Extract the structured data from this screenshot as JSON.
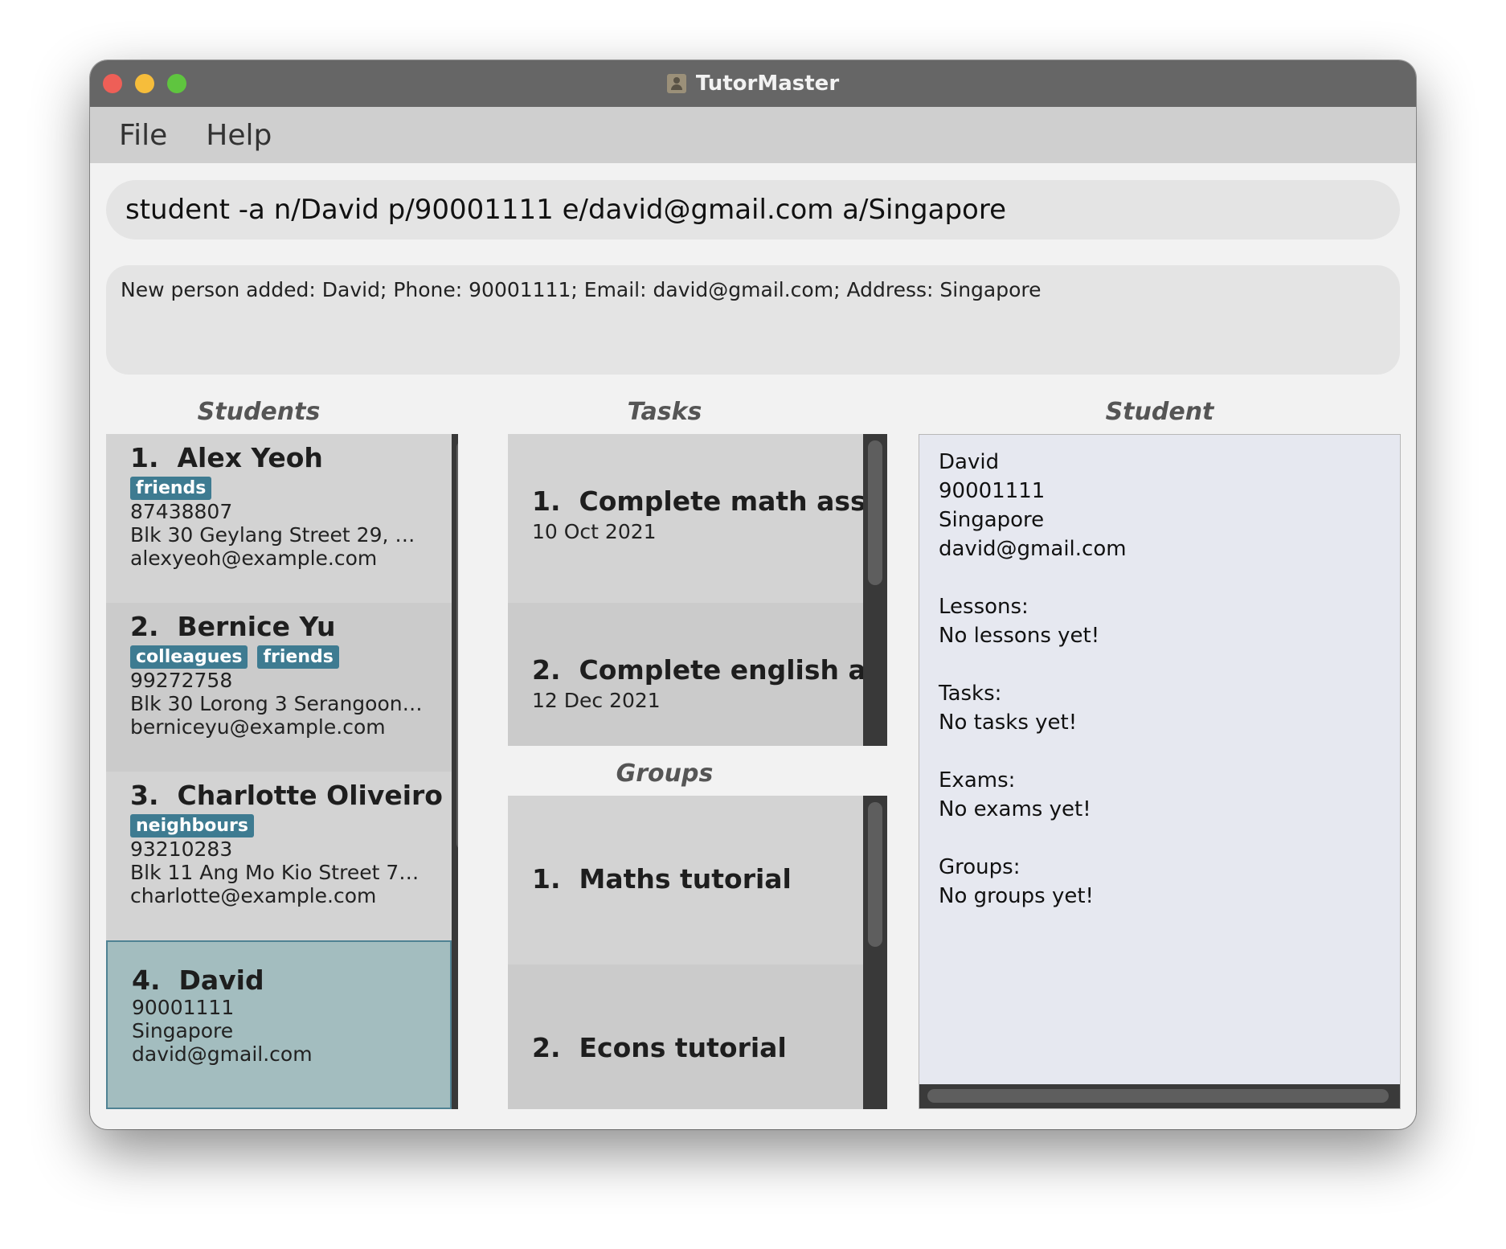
{
  "window": {
    "title": "TutorMaster"
  },
  "menu": {
    "file": "File",
    "help": "Help"
  },
  "command": {
    "value": "student -a n/David p/90001111 e/david@gmail.com a/Singapore"
  },
  "result": {
    "text": "New person added: David; Phone: 90001111; Email: david@gmail.com; Address: Singapore"
  },
  "students": {
    "title": "Students",
    "items": [
      {
        "index": "1.",
        "name": "Alex Yeoh",
        "tags": [
          "friends"
        ],
        "phone": "87438807",
        "address": "Blk 30 Geylang Street 29, #06-...",
        "email": "alexyeoh@example.com"
      },
      {
        "index": "2.",
        "name": "Bernice Yu",
        "tags": [
          "colleagues",
          "friends"
        ],
        "phone": "99272758",
        "address": "Blk 30 Lorong 3 Serangoon G...",
        "email": "berniceyu@example.com"
      },
      {
        "index": "3.",
        "name": "Charlotte Oliveiro",
        "tags": [
          "neighbours"
        ],
        "phone": "93210283",
        "address": "Blk 11 Ang Mo Kio Street 74, #...",
        "email": "charlotte@example.com"
      },
      {
        "index": "4.",
        "name": "David",
        "phone": "90001111",
        "address": "Singapore",
        "email": "david@gmail.com"
      }
    ]
  },
  "tasks": {
    "title": "Tasks",
    "items": [
      {
        "index": "1.",
        "name": "Complete math assi...",
        "date": "10 Oct 2021"
      },
      {
        "index": "2.",
        "name": "Complete english as...",
        "date": "12 Dec 2021"
      }
    ]
  },
  "groups": {
    "title": "Groups",
    "items": [
      {
        "index": "1.",
        "name": "Maths tutorial"
      },
      {
        "index": "2.",
        "name": "Econs tutorial"
      }
    ]
  },
  "student_detail": {
    "title": "Student",
    "name": "David",
    "phone": "90001111",
    "address": "Singapore",
    "email": "david@gmail.com",
    "lessons_label": "Lessons:",
    "lessons_value": "No lessons yet!",
    "tasks_label": "Tasks:",
    "tasks_value": "No tasks yet!",
    "exams_label": "Exams:",
    "exams_value": "No exams yet!",
    "groups_label": "Groups:",
    "groups_value": "No groups yet!"
  },
  "colors": {
    "titlebar": "#666666",
    "menubar": "#cfcfcf",
    "tag": "#3e7b91",
    "selected_card": "#a3bdbf",
    "detail_bg": "#e6e8f0"
  }
}
